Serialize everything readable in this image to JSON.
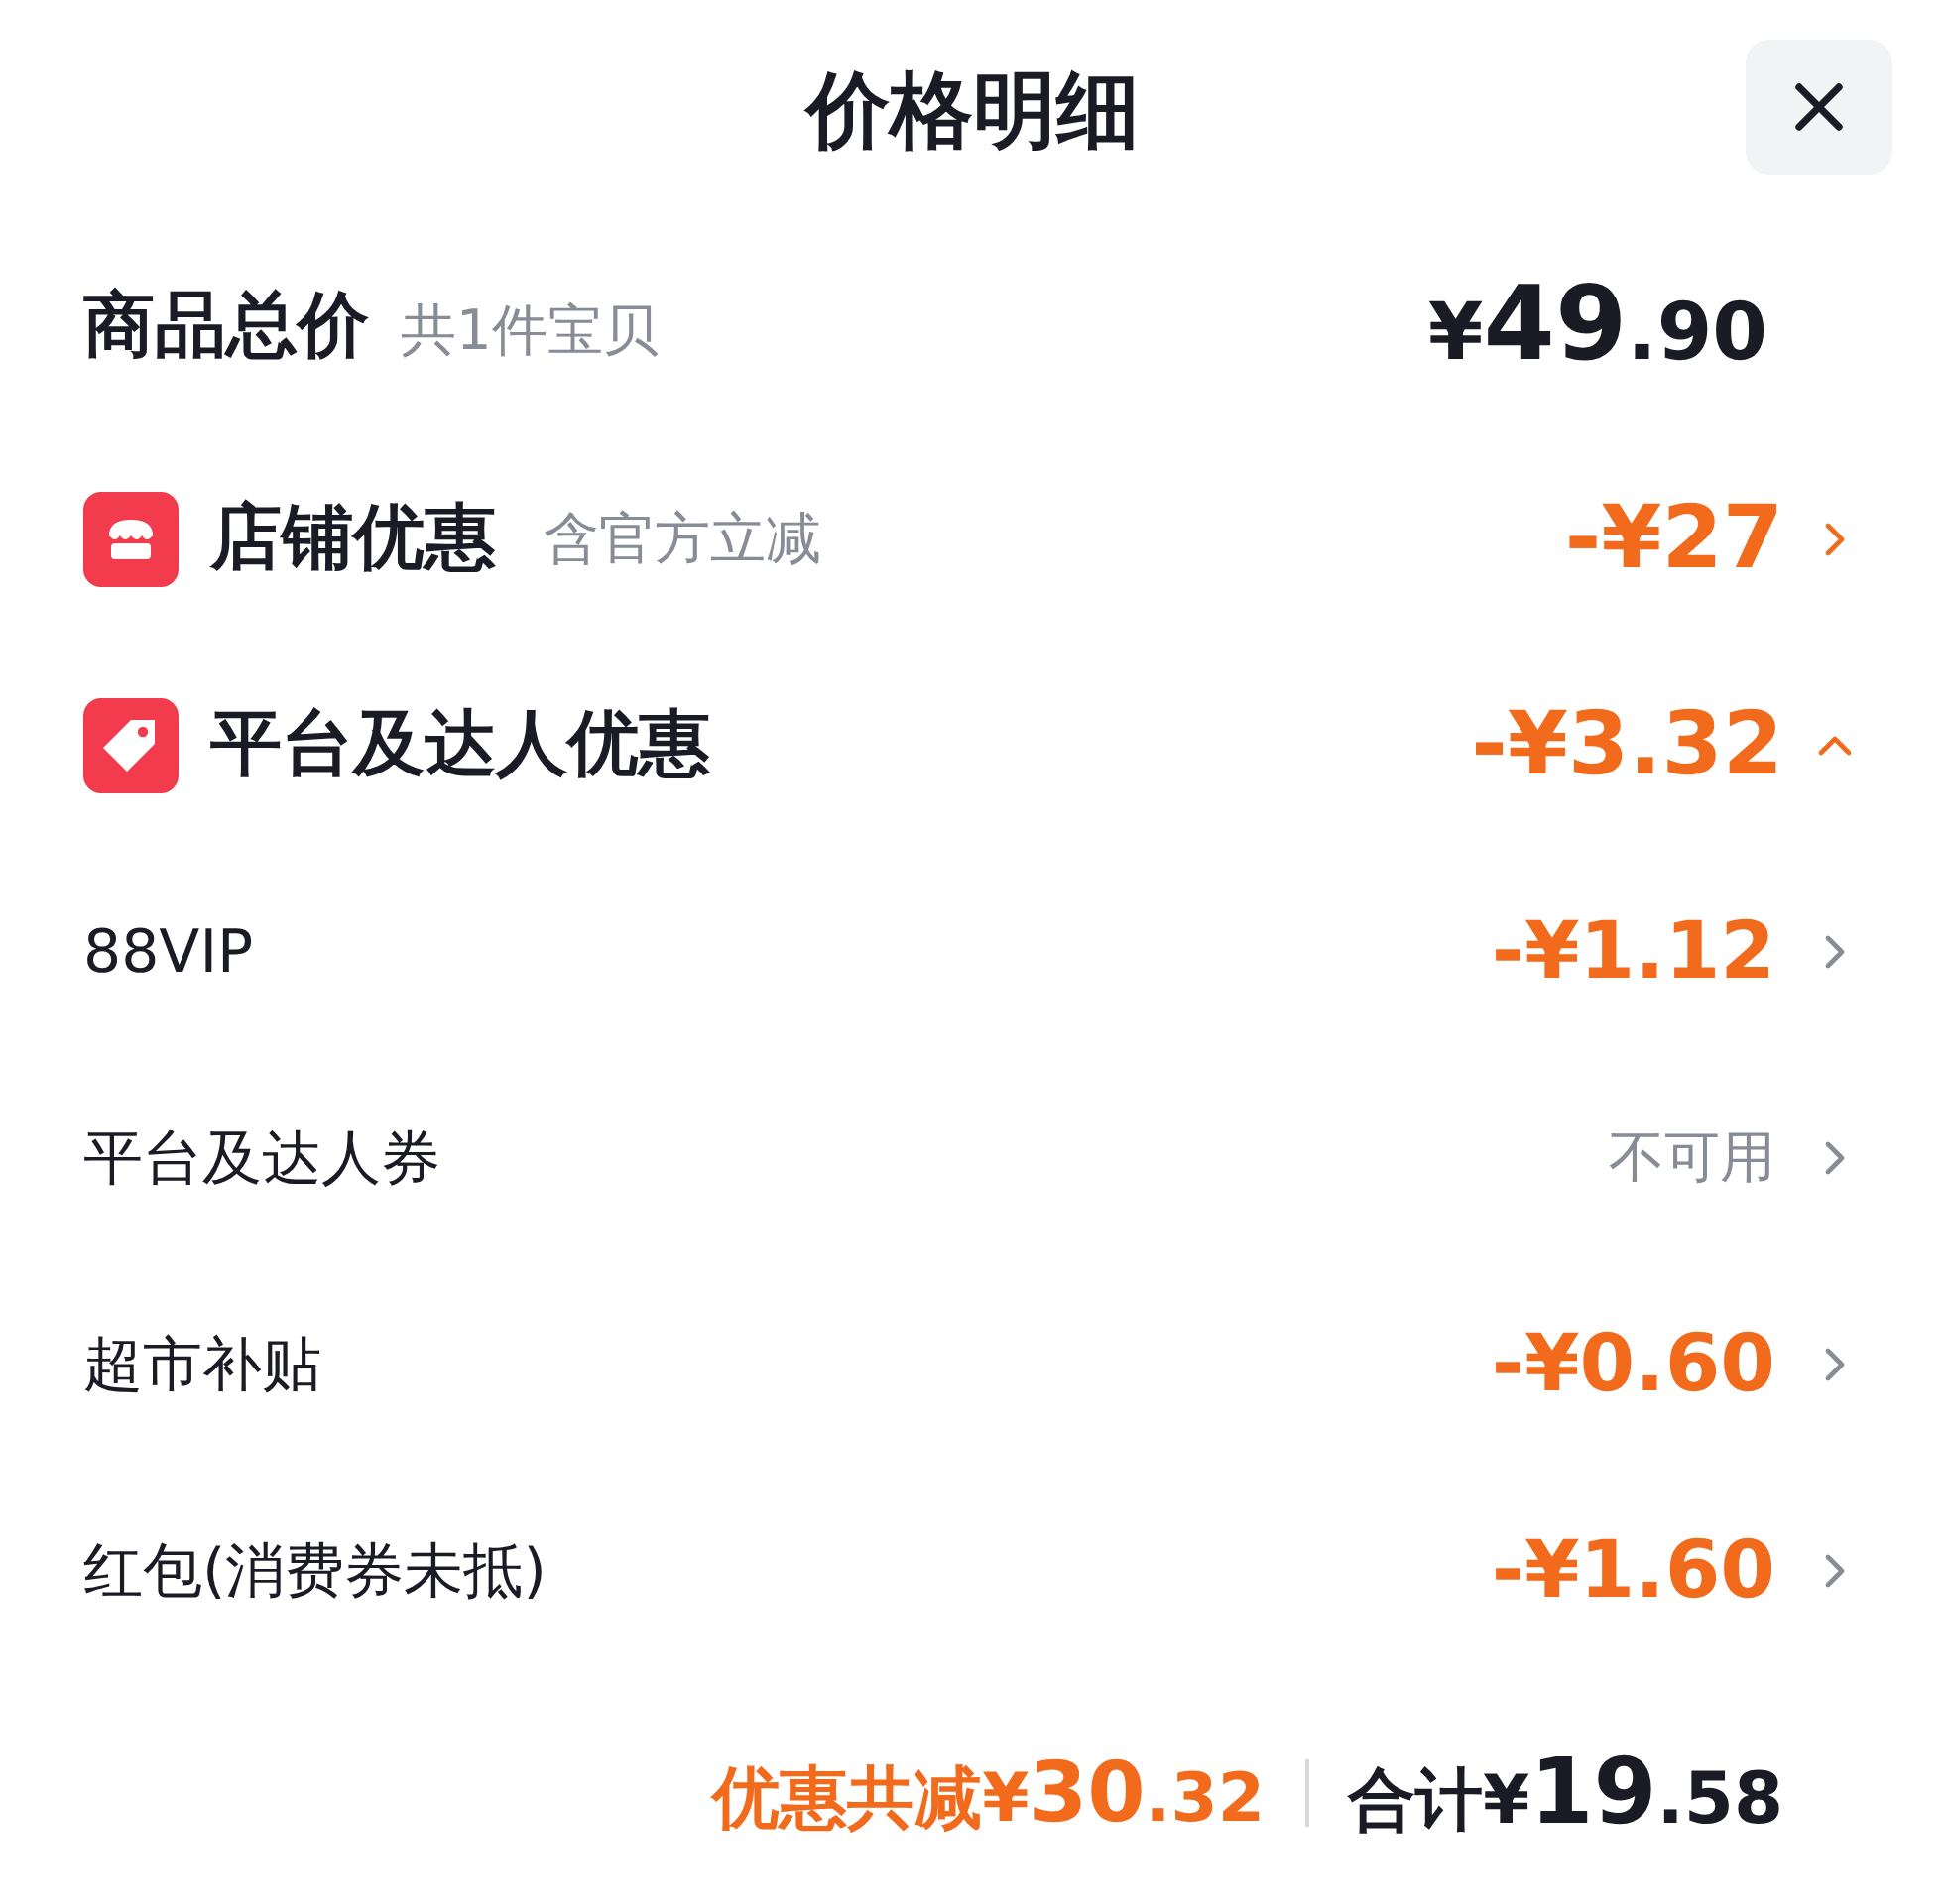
{
  "title": "价格明细",
  "total": {
    "label": "商品总价",
    "note": "共1件宝贝",
    "currency": "¥",
    "main": "49",
    "decimal": ".90"
  },
  "groups": [
    {
      "kind": "shop",
      "label": "店铺优惠",
      "note": "含官方立减",
      "amount": "-¥27",
      "expanded": false
    },
    {
      "kind": "tag",
      "label": "平台及达人优惠",
      "amount": "-¥3.32",
      "expanded": true,
      "items": [
        {
          "label": "88VIP",
          "amount": "-¥1.12",
          "kind": "discount"
        },
        {
          "label": "平台及达人券",
          "amount": "不可用",
          "kind": "unavailable"
        },
        {
          "label": "超市补贴",
          "amount": "-¥0.60",
          "kind": "discount"
        },
        {
          "label": "红包(消费券未抵)",
          "amount": "-¥1.60",
          "kind": "discount"
        }
      ]
    }
  ],
  "footer": {
    "savings": {
      "label": "优惠共减",
      "currency": "¥",
      "main": "30",
      "decimal": ".32"
    },
    "total": {
      "label": "合计",
      "currency": "¥",
      "main": "19",
      "decimal": ".58"
    }
  }
}
